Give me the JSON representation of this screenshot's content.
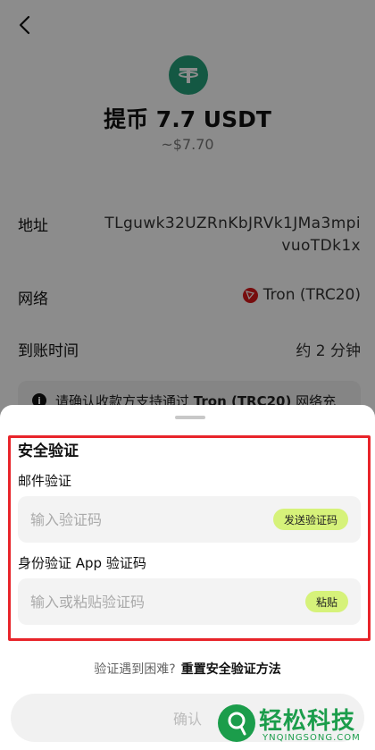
{
  "header": {
    "back_icon": "chevron-left-icon"
  },
  "coin": {
    "icon": "tether-icon",
    "color": "#26a17b"
  },
  "title": "提币 7.7 USDT",
  "subtitle": "~$7.70",
  "details": {
    "address_label": "地址",
    "address_value": "TLguwk32UZRnKbJRVk1JMa3mpivuoTDk1x",
    "network_label": "网络",
    "network_value": "Tron (TRC20)",
    "network_icon": "tron-icon",
    "arrival_label": "到账时间",
    "arrival_value": "约 2 分钟"
  },
  "notice": {
    "prefix": "请确认收款方支持通过 ",
    "network": "Tron (TRC20)",
    "suffix": " 网络充"
  },
  "sheet": {
    "title": "安全验证",
    "email_label": "邮件验证",
    "email_placeholder": "输入验证码",
    "send_code": "发送验证码",
    "auth_label": "身份验证 App 验证码",
    "auth_placeholder": "输入或粘贴验证码",
    "paste": "粘贴",
    "trouble_text": "验证遇到困难?",
    "trouble_link": "重置安全验证方法",
    "confirm": "确认"
  },
  "watermark": {
    "text": "轻松科技",
    "sub": "YNQINGSONG.COM"
  },
  "colors": {
    "accent_pill": "#d6f27a",
    "highlight": "#e8242a",
    "tron": "#d9181a"
  }
}
